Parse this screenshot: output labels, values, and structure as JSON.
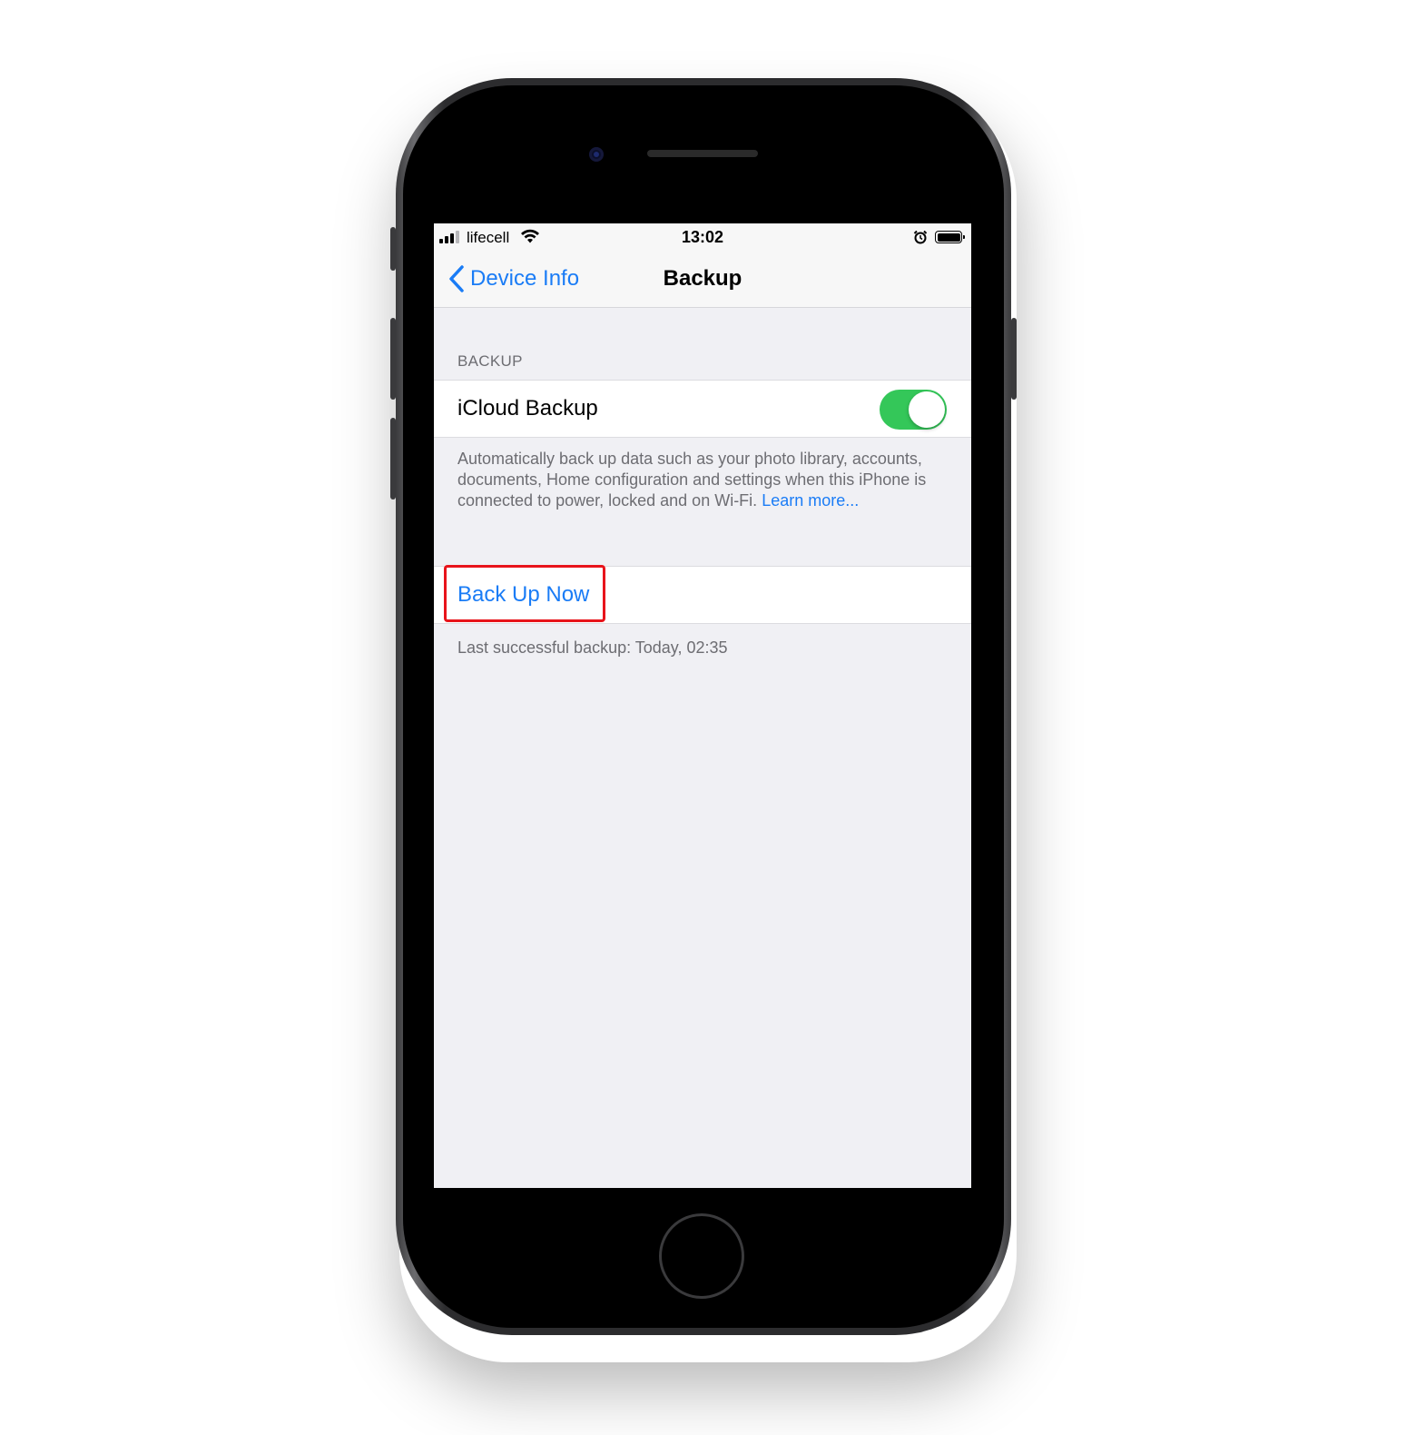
{
  "status_bar": {
    "carrier": "lifecell",
    "time": "13:02",
    "signal_bars_active": 3,
    "signal_bars_total": 4,
    "battery_level": 1.0
  },
  "nav": {
    "back_label": "Device Info",
    "title": "Backup"
  },
  "backup_section": {
    "header": "BACKUP",
    "icloud_backup_label": "iCloud Backup",
    "icloud_backup_enabled": true,
    "description": "Automatically back up data such as your photo library, accounts, documents, Home configuration and settings when this iPhone is connected to power, locked and on Wi-Fi.",
    "learn_more": "Learn more..."
  },
  "backup_now": {
    "label": "Back Up Now",
    "last_backup": "Last successful backup: Today, 02:35"
  },
  "colors": {
    "accent": "#1a7cf6",
    "toggle_on": "#34c759",
    "highlight": "#e8141b",
    "background": "#f0f0f4"
  },
  "icons": [
    "signal-icon",
    "wifi-icon",
    "alarm-icon",
    "battery-icon",
    "chevron-left-icon"
  ]
}
